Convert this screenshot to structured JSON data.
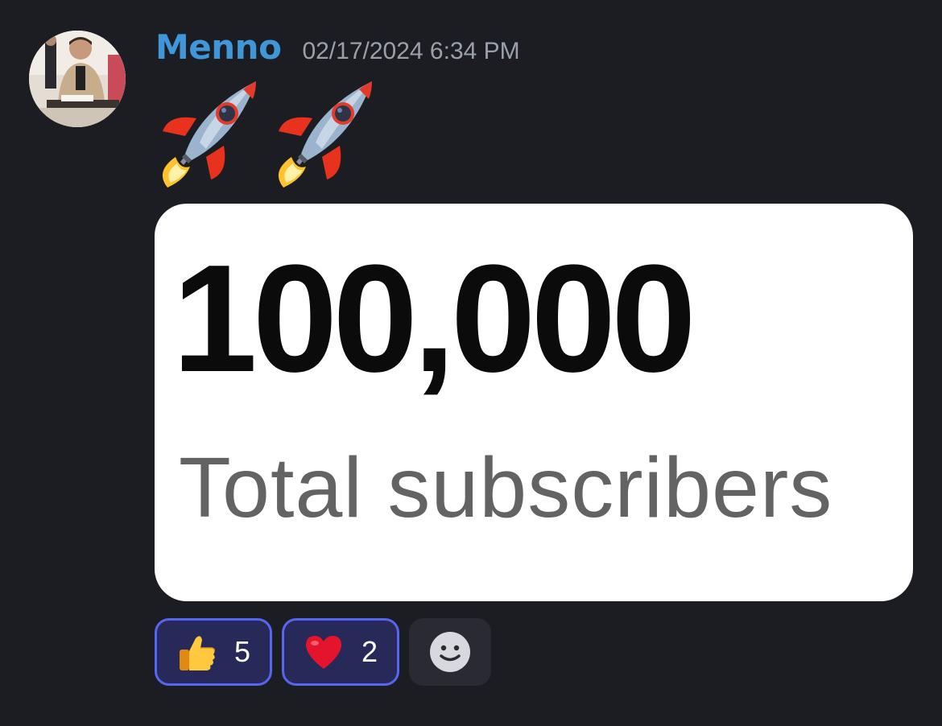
{
  "message": {
    "author": "Menno",
    "timestamp": "02/17/2024 6:34 PM",
    "content_emojis": [
      "rocket",
      "rocket"
    ],
    "avatar_icon": "user-avatar-photo"
  },
  "attachment": {
    "number": "100,000",
    "caption": "Total subscribers"
  },
  "reactions": [
    {
      "emoji": "thumbs-up",
      "count": "5",
      "active": true
    },
    {
      "emoji": "red-heart",
      "count": "2",
      "active": true
    }
  ],
  "add_reaction_icon": "smiley-add-icon",
  "colors": {
    "background": "#1c1d23",
    "username": "#3f96d8",
    "timestamp": "#9aa0ab",
    "reaction_active_bg": "#272a58",
    "reaction_active_border": "#5865f2"
  }
}
